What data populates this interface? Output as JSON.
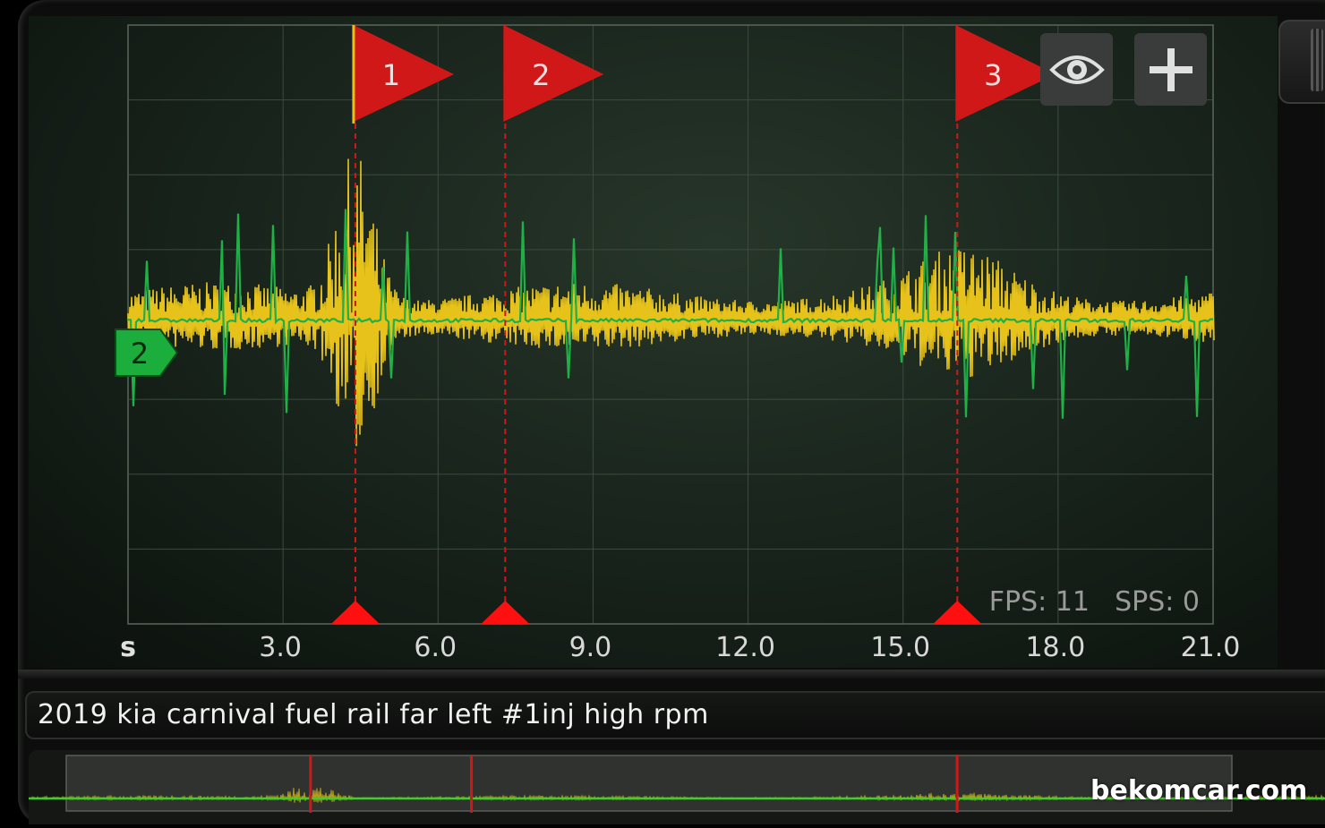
{
  "scope": {
    "time_unit": "s",
    "x_ticks": [
      "3.0",
      "6.0",
      "9.0",
      "12.0",
      "15.0",
      "18.0",
      "21.0"
    ],
    "fps_label": "FPS: 11",
    "sps_label": "SPS: 0",
    "channel_marker": "2",
    "markers": [
      {
        "label": "1",
        "time": 4.4
      },
      {
        "label": "2",
        "time": 7.3
      },
      {
        "label": "3",
        "time": 16.05
      }
    ],
    "colors": {
      "channel_a": "#e6c21a",
      "channel_b": "#1fb046",
      "marker": "#d01818",
      "grid": "#3d4b3f",
      "text": "#d8d8d8"
    }
  },
  "toolbar": {
    "eye_icon": "eye-icon",
    "plus_icon": "plus-icon"
  },
  "recording": {
    "title": "2019 kia carnival fuel rail far left #1inj high rpm"
  },
  "watermark": "bekomcar.com"
}
